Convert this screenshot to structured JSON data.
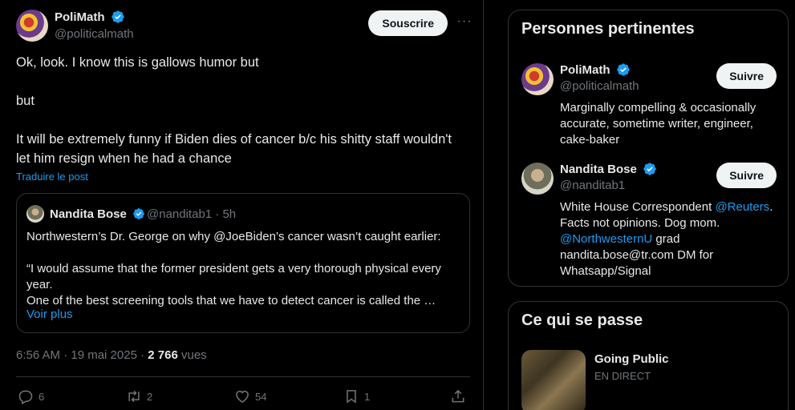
{
  "tweet": {
    "author_name": "PoliMath",
    "author_handle": "@politicalmath",
    "subscribe_label": "Souscrire",
    "more_label": "···",
    "lines": [
      "Ok, look. I know this is gallows humor but",
      "but",
      "It will be extremely funny if Biden dies of cancer b/c his shitty staff wouldn't let him resign when he had a chance"
    ],
    "translate_label": "Traduire le post",
    "timestamp": "6:56 AM · 19 mai 2025 · ",
    "views_count": "2 766",
    "views_label": " vues",
    "actions": {
      "replies": "6",
      "reposts": "2",
      "likes": "54",
      "bookmarks": "1"
    }
  },
  "quote": {
    "author_name": "Nandita Bose",
    "meta": "@nanditab1 · 5h",
    "line1": "Northwestern’s Dr. George on why @JoeBiden’s cancer wasn’t caught earlier:",
    "line2": "“I would assume that the former president gets a very thorough physical every year.",
    "line3": "One of the best screening tools that we have to detect cancer is called the …",
    "see_more": "Voir plus"
  },
  "sidebar": {
    "people_title": "Personnes pertinentes",
    "people": [
      {
        "name": "PoliMath",
        "handle": "@politicalmath",
        "follow_label": "Suivre",
        "bio": "Marginally compelling & occasionally accurate, sometime writer, engineer, cake-baker"
      },
      {
        "name": "Nandita Bose",
        "handle": "@nanditab1",
        "follow_label": "Suivre",
        "bio_part1": "White House Correspondent ",
        "bio_link1": "@Reuters",
        "bio_part2": ". Facts not opinions. Dog mom. ",
        "bio_link2": "@NorthwesternU",
        "bio_part3": " grad nandita.bose@tr.com DM for Whatsapp/Signal"
      }
    ],
    "happening_title": "Ce qui se passe",
    "happening_item": {
      "title": "Going Public",
      "status": "EN DIRECT"
    }
  },
  "colors": {
    "accent": "#1d9bf0",
    "background": "#000000",
    "text": "#e7e9ea",
    "muted": "#71767b",
    "border": "#2f3336"
  },
  "icons": [
    "verified-badge-icon",
    "more-icon",
    "reply-icon",
    "repost-icon",
    "like-icon",
    "bookmark-icon",
    "share-icon"
  ]
}
